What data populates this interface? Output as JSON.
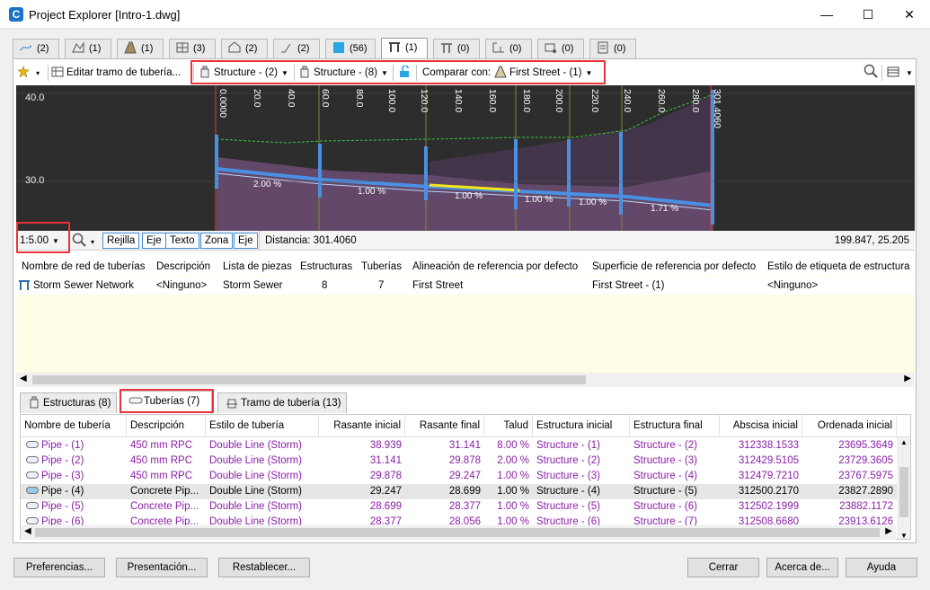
{
  "window": {
    "title": "Project Explorer [Intro-1.dwg]",
    "app_icon": "C",
    "controls": [
      "—",
      "☐",
      "✕"
    ]
  },
  "collection_tabs": [
    {
      "count": "(2)",
      "icon": "alignment-icon"
    },
    {
      "count": "(1)",
      "icon": "surface-icon"
    },
    {
      "count": "(1)",
      "icon": "corridor-icon"
    },
    {
      "count": "(3)",
      "icon": "assembly-icon"
    },
    {
      "count": "(2)",
      "icon": "parcel-icon"
    },
    {
      "count": "(2)",
      "icon": "featureline-icon"
    },
    {
      "count": "(56)",
      "icon": "profile-icon"
    },
    {
      "count": "(1)",
      "icon": "pipe-network-icon"
    },
    {
      "count": "(0)",
      "icon": "pressure-network-icon"
    },
    {
      "count": "(0)",
      "icon": "grading-icon"
    },
    {
      "count": "(0)",
      "icon": "point-group-icon"
    },
    {
      "count": "(0)",
      "icon": "sheet-set-icon"
    }
  ],
  "toolbar": {
    "edit_run_label": "Editar tramo de tubería...",
    "from_structure": "Structure - (2)",
    "to_structure": "Structure - (8)",
    "compare_label": "Comparar con:",
    "compare_target": "First Street - (1)"
  },
  "profile_view": {
    "y_labels": [
      "40.0",
      "30.0"
    ],
    "stations": [
      "0.0000",
      "20.0",
      "40.0",
      "60.0",
      "80.0",
      "100.0",
      "120.0",
      "140.0",
      "160.0",
      "180.0",
      "200.0",
      "220.0",
      "240.0",
      "260.0",
      "280.0",
      "301.4060"
    ],
    "slopes": [
      "2.00 %",
      "1.00 %",
      "1.00 %",
      "1.00 %",
      "1.00 %",
      "1.71 %"
    ]
  },
  "profile_bar": {
    "scale": "1:5.00",
    "toggles": [
      "Rejilla",
      "Eje",
      "Texto",
      "Zona",
      "Eje"
    ],
    "distance": "Distancia: 301.4060",
    "coords": "199.847, 25.205"
  },
  "network_table": {
    "headers": [
      "Nombre de red de tuberías",
      "Descripción",
      "Lista de piezas",
      "Estructuras",
      "Tuberías",
      "Alineación de referencia por defecto",
      "Superficie de referencia por defecto",
      "Estilo de etiqueta de estructura"
    ],
    "row": [
      "Storm Sewer Network",
      "<Ninguno>",
      "Storm Sewer",
      "8",
      "7",
      "First Street",
      "First Street - (1)",
      "<Ninguno>"
    ]
  },
  "bottom_tabs": [
    "Estructuras (8)",
    "Tuberías (7)",
    "Tramo de tubería (13)"
  ],
  "pipe_table": {
    "headers": [
      "Nombre de tubería",
      "Descripción",
      "Estilo de tubería",
      "Rasante inicial",
      "Rasante final",
      "Talud",
      "Estructura inicial",
      "Estructura final",
      "Abscisa inicial",
      "Ordenada inicial"
    ],
    "rows": [
      [
        "Pipe - (1)",
        "450 mm RPC",
        "Double Line (Storm)",
        "38.939",
        "31.141",
        "8.00 %",
        "Structure - (1)",
        "Structure - (2)",
        "312338.1533",
        "23695.3649"
      ],
      [
        "Pipe - (2)",
        "450 mm RPC",
        "Double Line (Storm)",
        "31.141",
        "29.878",
        "2.00 %",
        "Structure - (2)",
        "Structure - (3)",
        "312429.5105",
        "23729.3605"
      ],
      [
        "Pipe - (3)",
        "450 mm RPC",
        "Double Line (Storm)",
        "29.878",
        "29.247",
        "1.00 %",
        "Structure - (3)",
        "Structure - (4)",
        "312479.7210",
        "23767.5975"
      ],
      [
        "Pipe - (4)",
        "Concrete Pip...",
        "Double Line (Storm)",
        "29.247",
        "28.699",
        "1.00 %",
        "Structure - (4)",
        "Structure - (5)",
        "312500.2170",
        "23827.2890"
      ],
      [
        "Pipe - (5)",
        "Concrete Pip...",
        "Double Line (Storm)",
        "28.699",
        "28.377",
        "1.00 %",
        "Structure - (5)",
        "Structure - (6)",
        "312502.1999",
        "23882.1172"
      ],
      [
        "Pipe - (6)",
        "Concrete Pip...",
        "Double Line (Storm)",
        "28.377",
        "28.056",
        "1.00 %",
        "Structure - (6)",
        "Structure - (7)",
        "312508.6680",
        "23913.6126"
      ]
    ]
  },
  "footer": {
    "preferences": "Preferencias...",
    "presentation": "Presentación...",
    "reset": "Restablecer...",
    "close": "Cerrar",
    "about": "Acerca de...",
    "help": "Ayuda"
  },
  "colors": {
    "accent": "#3f8ad4",
    "highlight_box": "#e8343a",
    "pipe_text": "#8a1ea6",
    "profile_bg": "#2d2d2d"
  }
}
